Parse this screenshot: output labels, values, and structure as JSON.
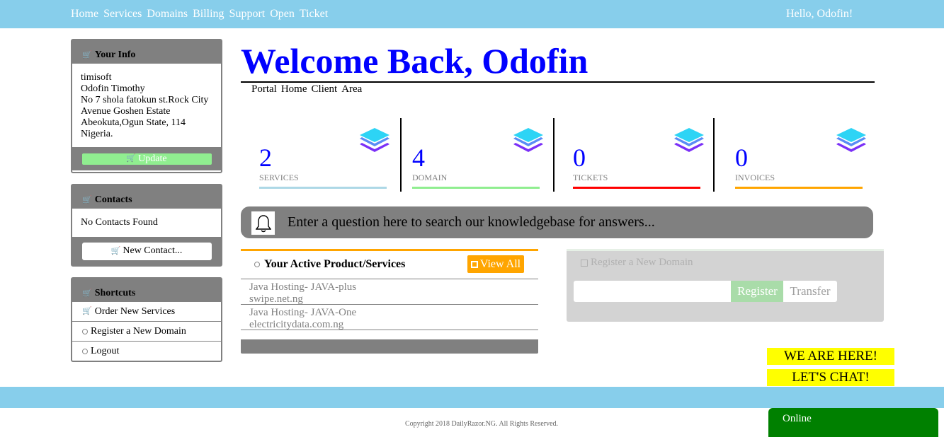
{
  "nav": {
    "items": [
      "Home",
      "Services",
      "Domains",
      "Billing",
      "Support",
      "Open",
      "Ticket"
    ],
    "greeting": "Hello,  Odofin!"
  },
  "your_info": {
    "title": "Your Info",
    "lines": [
      "timisoft",
      "Odofin Timothy",
      "No 7 shola fatokun st.Rock City",
      "Avenue Goshen Estate",
      "Abeokuta,Ogun State, 114",
      "Nigeria."
    ],
    "update_label": "Update"
  },
  "contacts": {
    "title": "Contacts",
    "empty_text": "No Contacts Found",
    "new_label": "New Contact..."
  },
  "shortcuts": {
    "title": "Shortcuts",
    "items": [
      "Order New Services",
      "Register a New Domain",
      "Logout"
    ]
  },
  "welcome": {
    "title": "Welcome Back, Odofin",
    "breadcrumb": [
      "Portal",
      "Home",
      "Client",
      "Area"
    ]
  },
  "stats": [
    {
      "value": "2",
      "label": "SERVICES",
      "color": "#add8e6"
    },
    {
      "value": "4",
      "label": "DOMAIN",
      "color": "#90ee90"
    },
    {
      "value": "0",
      "label": "TICKETS",
      "color": "#ff0000"
    },
    {
      "value": "0",
      "label": "INVOICES",
      "color": "#ffa500"
    }
  ],
  "knowledgebase": {
    "placeholder": "Enter a question here to search our knowledgebase for answers..."
  },
  "products": {
    "title": "Your Active Product/Services",
    "view_all": "View All",
    "items": [
      {
        "name": "Java Hosting- JAVA-plus",
        "domain": "swipe.net.ng"
      },
      {
        "name": "Java Hosting- JAVA-One",
        "domain": "electricitydata.com.ng"
      }
    ]
  },
  "domain_box": {
    "title": "Register a New Domain",
    "input_value": "",
    "register_label": "Register",
    "transfer_label": "Transfer"
  },
  "chat": {
    "line1": "WE ARE HERE!",
    "line2": "LET'S CHAT!",
    "status": "Online"
  },
  "footer": {
    "copyright": "Copyright 2018 DailyRazor.NG. All Rights Reserved."
  },
  "colors": {
    "topbar": "#87ceeb",
    "panel": "#808080",
    "accent_blue": "#0000ff",
    "orange": "#ffa500",
    "online_green": "#008000"
  },
  "icons": {
    "cart": "cart-icon",
    "stack": "layers-icon",
    "bell": "bell-icon",
    "bullet": "circle-bullet-icon"
  }
}
